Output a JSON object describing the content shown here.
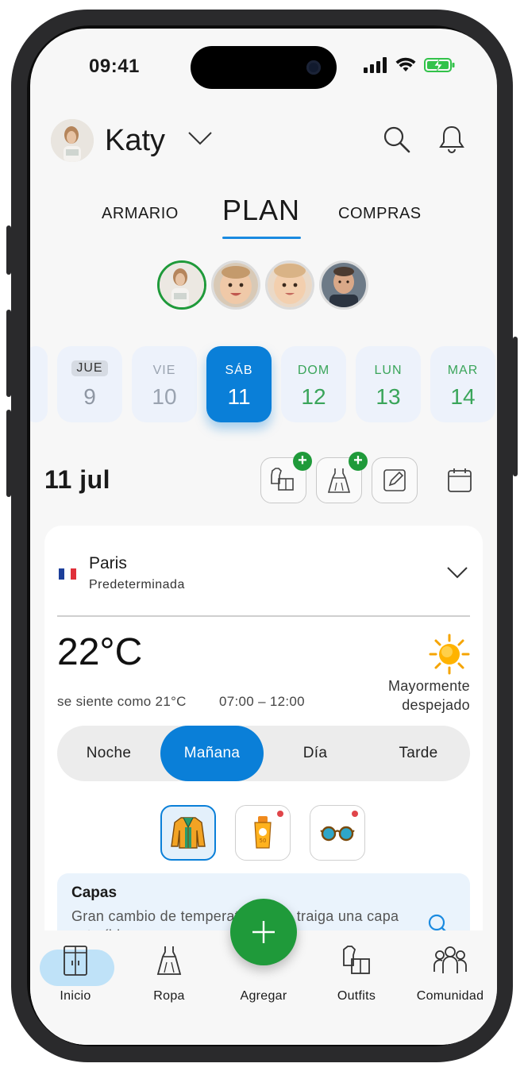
{
  "status_bar": {
    "time": "09:41"
  },
  "header": {
    "user_name": "Katy"
  },
  "tabs": [
    {
      "label": "ARMARIO"
    },
    {
      "label": "PLAN"
    },
    {
      "label": "COMPRAS"
    }
  ],
  "days": [
    {
      "name": "JUE",
      "num": "9",
      "state": "today"
    },
    {
      "name": "VIE",
      "num": "10",
      "state": "past"
    },
    {
      "name": "SÁB",
      "num": "11",
      "state": "selected"
    },
    {
      "name": "DOM",
      "num": "12",
      "state": "future"
    },
    {
      "name": "LUN",
      "num": "13",
      "state": "future"
    },
    {
      "name": "MAR",
      "num": "14",
      "state": "future"
    }
  ],
  "date_title": "11 jul",
  "weather": {
    "city": "Paris",
    "city_subtitle": "Predeterminada",
    "temperature": "22°C",
    "condition_line1": "Mayormente",
    "condition_line2": "despejado",
    "feels_like": "se siente como 21°C",
    "hours": "07:00 – 12:00",
    "segments": [
      "Noche",
      "Mañana",
      "Día",
      "Tarde"
    ],
    "active_segment": "Mañana"
  },
  "advice": {
    "title": "Capas",
    "text": "Gran cambio de temperatura hoy: traiga una capa extraíble."
  },
  "bottom_nav": [
    {
      "label": "Inicio",
      "icon": "wardrobe-icon"
    },
    {
      "label": "Ropa",
      "icon": "dress-icon"
    },
    {
      "label": "Agregar",
      "icon": "plus-icon"
    },
    {
      "label": "Outfits",
      "icon": "outfits-icon"
    },
    {
      "label": "Comunidad",
      "icon": "community-icon"
    }
  ],
  "colors": {
    "accent_blue": "#0a7fd8",
    "accent_green": "#1f9a3a",
    "day_future_text": "#3aa55a",
    "nav_active_pill": "#bfe2f8"
  }
}
